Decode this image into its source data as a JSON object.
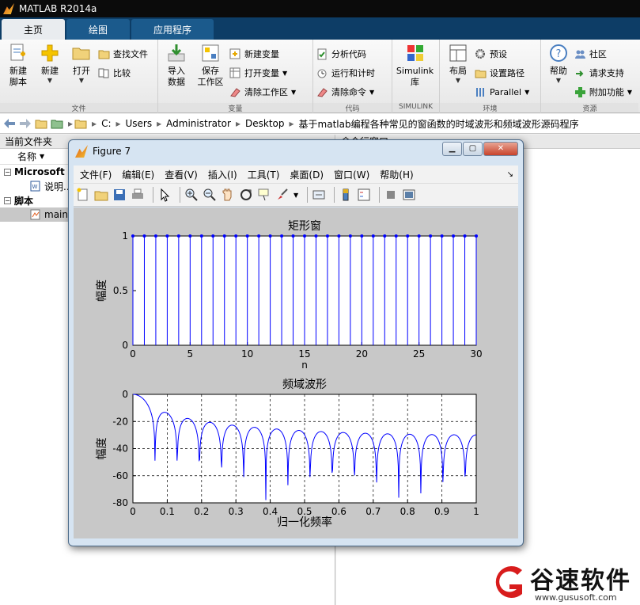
{
  "app": {
    "title": "MATLAB R2014a"
  },
  "tabs": [
    "主页",
    "绘图",
    "应用程序"
  ],
  "ribbon": {
    "file": {
      "new_script": "新建\n脚本",
      "new": "新建",
      "open": "打开",
      "find_files": "查找文件",
      "compare": "比较",
      "label": "文件"
    },
    "variable": {
      "import": "导入\n数据",
      "save_ws": "保存\n工作区",
      "new_var": "新建变量",
      "open_var": "打开变量",
      "clear_ws": "清除工作区",
      "label": "变量"
    },
    "code": {
      "analyze": "分析代码",
      "run_time": "运行和计时",
      "clear_cmd": "清除命令",
      "label": "代码"
    },
    "simulink": {
      "lib": "Simulink\n库",
      "label": "SIMULINK"
    },
    "env": {
      "layout": "布局",
      "prefs": "预设",
      "set_path": "设置路径",
      "parallel": "Parallel",
      "label": "环境"
    },
    "resources": {
      "help": "帮助",
      "community": "社区",
      "support": "请求支持",
      "addons": "附加功能",
      "label": "资源"
    }
  },
  "address": {
    "crumbs": [
      "C:",
      "Users",
      "Administrator",
      "Desktop",
      "基于matlab编程各种常见的窗函数的时域波形和频域波形源码程序"
    ]
  },
  "left_panel": {
    "title": "当前文件夹",
    "col_name": "名称",
    "groups": [
      {
        "label": "Microsoft",
        "items": [
          "说明..."
        ]
      },
      {
        "label": "脚本",
        "items": [
          "main"
        ]
      }
    ]
  },
  "right_panel": {
    "title": "命令行窗口"
  },
  "figure": {
    "title": "Figure 7",
    "menu": [
      "文件(F)",
      "编辑(E)",
      "查看(V)",
      "插入(I)",
      "工具(T)",
      "桌面(D)",
      "窗口(W)",
      "帮助(H)"
    ]
  },
  "chart_data": [
    {
      "type": "stem",
      "title": "矩形窗",
      "xlabel": "n",
      "ylabel": "幅度",
      "xlim": [
        0,
        30
      ],
      "ylim": [
        0,
        1
      ],
      "xticks": [
        0,
        5,
        10,
        15,
        20,
        25,
        30
      ],
      "yticks": [
        0,
        0.5,
        1
      ],
      "x": [
        0,
        1,
        2,
        3,
        4,
        5,
        6,
        7,
        8,
        9,
        10,
        11,
        12,
        13,
        14,
        15,
        16,
        17,
        18,
        19,
        20,
        21,
        22,
        23,
        24,
        25,
        26,
        27,
        28,
        29,
        30
      ],
      "y": [
        1,
        1,
        1,
        1,
        1,
        1,
        1,
        1,
        1,
        1,
        1,
        1,
        1,
        1,
        1,
        1,
        1,
        1,
        1,
        1,
        1,
        1,
        1,
        1,
        1,
        1,
        1,
        1,
        1,
        1,
        1
      ],
      "grid": false,
      "color": "#0000ff"
    },
    {
      "type": "line",
      "title": "频域波形",
      "xlabel": "归一化频率",
      "ylabel": "幅度",
      "xlim": [
        0,
        1
      ],
      "ylim": [
        -80,
        0
      ],
      "xticks": [
        0,
        0.1,
        0.2,
        0.3,
        0.4,
        0.5,
        0.6,
        0.7,
        0.8,
        0.9,
        1
      ],
      "yticks": [
        0,
        -20,
        -40,
        -60,
        -80
      ],
      "window_length": 31,
      "grid": true,
      "color": "#0000ff"
    }
  ],
  "watermark": {
    "brand": "谷速软件",
    "url": "www.gususoft.com"
  }
}
